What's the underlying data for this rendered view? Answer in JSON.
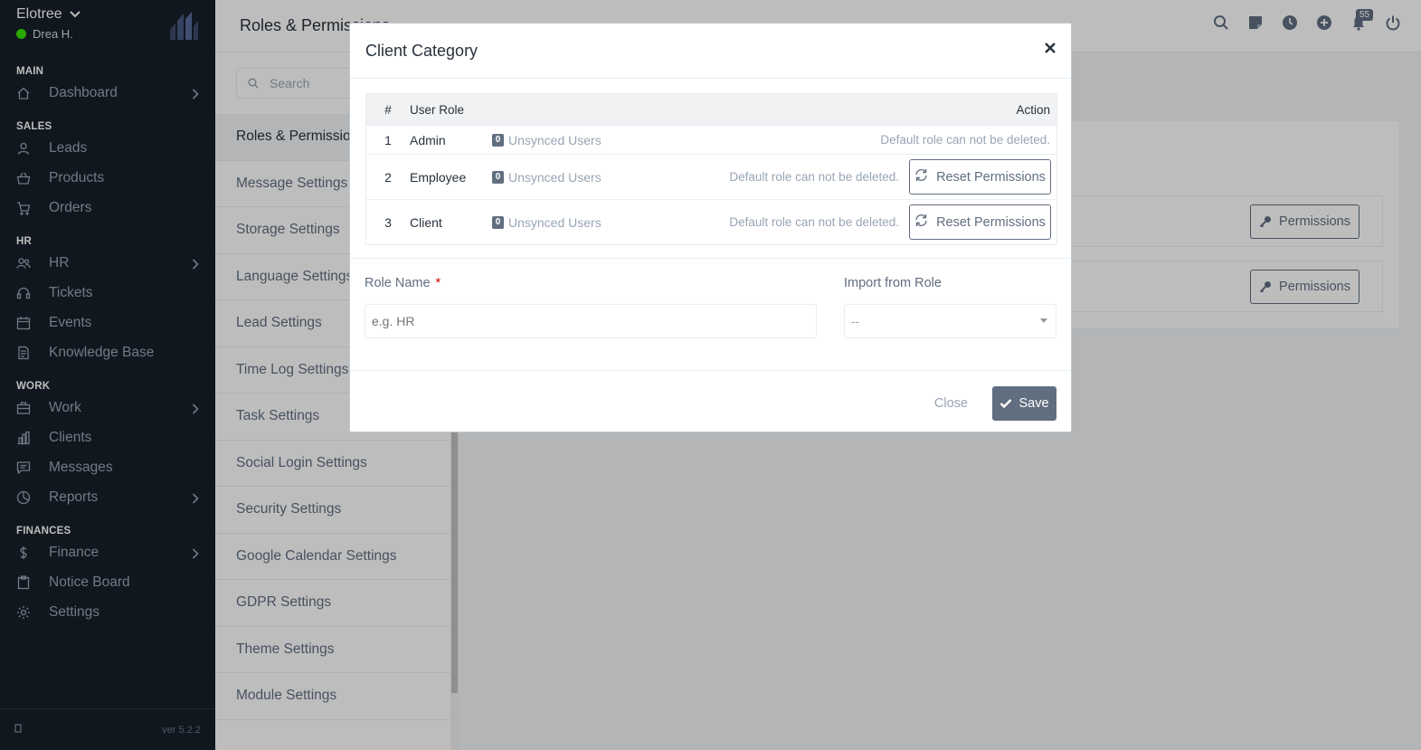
{
  "brand": {
    "name": "Elotree",
    "user": "Drea H."
  },
  "sidebar": {
    "sections": [
      {
        "title": "MAIN",
        "items": [
          {
            "label": "Dashboard",
            "icon": "house-icon",
            "has_sub": true
          }
        ]
      },
      {
        "title": "SALES",
        "items": [
          {
            "label": "Leads",
            "icon": "user-icon",
            "has_sub": false
          },
          {
            "label": "Products",
            "icon": "basket-icon",
            "has_sub": false
          },
          {
            "label": "Orders",
            "icon": "cart-icon",
            "has_sub": false
          }
        ]
      },
      {
        "title": "HR",
        "items": [
          {
            "label": "HR",
            "icon": "people-icon",
            "has_sub": true
          },
          {
            "label": "Tickets",
            "icon": "headset-icon",
            "has_sub": false
          },
          {
            "label": "Events",
            "icon": "calendar-icon",
            "has_sub": false
          },
          {
            "label": "Knowledge Base",
            "icon": "document-icon",
            "has_sub": false
          }
        ]
      },
      {
        "title": "WORK",
        "items": [
          {
            "label": "Work",
            "icon": "briefcase-icon",
            "has_sub": true
          },
          {
            "label": "Clients",
            "icon": "building-icon",
            "has_sub": false
          },
          {
            "label": "Messages",
            "icon": "chat-icon",
            "has_sub": false
          },
          {
            "label": "Reports",
            "icon": "pie-chart-icon",
            "has_sub": true
          }
        ]
      },
      {
        "title": "FINANCES",
        "items": [
          {
            "label": "Finance",
            "icon": "dollar-icon",
            "has_sub": true
          },
          {
            "label": "Notice Board",
            "icon": "clipboard-icon",
            "has_sub": false
          },
          {
            "label": "Settings",
            "icon": "gear-icon",
            "has_sub": false
          }
        ]
      }
    ],
    "version": "ver 5.2.2"
  },
  "header": {
    "title": "Roles & Permissions",
    "notification_count": "55"
  },
  "settings_menu": {
    "search_placeholder": "Search",
    "items": [
      "Roles & Permissions",
      "Message Settings",
      "Storage Settings",
      "Language Settings",
      "Lead Settings",
      "Time Log Settings",
      "Task Settings",
      "Social Login Settings",
      "Security Settings",
      "Google Calendar Settings",
      "GDPR Settings",
      "Theme Settings",
      "Module Settings"
    ]
  },
  "background": {
    "permissions_label": "Permissions"
  },
  "modal": {
    "title": "Client Category",
    "table": {
      "col_num": "#",
      "col_role": "User Role",
      "col_action": "Action",
      "rows": [
        {
          "num": "1",
          "role": "Admin",
          "count": "0",
          "unsynced": "Unsynced Users",
          "note": "Default role can not be deleted.",
          "reset": ""
        },
        {
          "num": "2",
          "role": "Employee",
          "count": "0",
          "unsynced": "Unsynced Users",
          "note": "Default role can not be deleted.",
          "reset": "Reset Permissions"
        },
        {
          "num": "3",
          "role": "Client",
          "count": "0",
          "unsynced": "Unsynced Users",
          "note": "Default role can not be deleted.",
          "reset": "Reset Permissions"
        }
      ]
    },
    "form": {
      "role_name_label": "Role Name",
      "required_mark": "*",
      "role_name_placeholder": "e.g. HR",
      "import_label": "Import from Role",
      "import_value": "--"
    },
    "close_label": "Close",
    "save_label": "Save"
  }
}
